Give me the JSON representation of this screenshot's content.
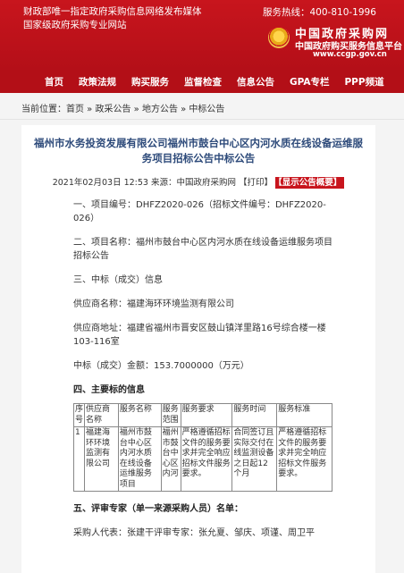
{
  "topbar": {
    "left_text": "财政部唯一指定政府采购信息网络发布媒体 国家级政府采购专业网站",
    "hotline": "服务热线：400-810-1996",
    "brand_line1": "中国政府采购网",
    "brand_line2": "中国政府购买服务信息平台",
    "brand_url": "www.ccgp.gov.cn"
  },
  "nav": [
    "首页",
    "政策法规",
    "购买服务",
    "监督检查",
    "信息公告",
    "GPA专栏",
    "PPP频道"
  ],
  "breadcrumb": "当前位置：首页 » 政采公告 » 地方公告 » 中标公告",
  "article": {
    "title": "福州市水务投资发展有限公司福州市鼓台中心区内河水质在线设备运维服务项目招标公告中标公告",
    "meta_date": "2021年02月03日 12:53 来源：中国政府采购网",
    "print_label": "【打印】",
    "summary_label": "【显示公告概要】",
    "sec1": "一、项目编号：DHFZ2020-026（招标文件编号：DHFZ2020-026）",
    "sec2": "二、项目名称：福州市鼓台中心区内河水质在线设备运维服务项目招标公告",
    "sec3": "三、中标（成交）信息",
    "supplier_name": "供应商名称：福建海环环境监测有限公司",
    "supplier_addr": "供应商地址：福建省福州市晋安区鼓山镇洋里路16号综合楼一楼103-116室",
    "amount": "中标（成交）金额：153.7000000（万元）",
    "sec4": "四、主要标的信息",
    "table_headers": [
      "序号",
      "供应商名称",
      "服务名称",
      "服务范围",
      "服务要求",
      "服务时间",
      "服务标准"
    ],
    "table_row": [
      "1",
      "福建海环环境监测有限公司",
      "福州市鼓台中心区内河水质在线设备运维服务项目",
      "福州市鼓台中心区内河",
      "严格遵循招标文件的服务要求并完全响应招标文件服务要求。",
      "合同签订且实际交付在线监测设备之日起12个月",
      "严格遵循招标文件的服务要求并完全响应招标文件服务要求。"
    ],
    "sec5": "五、评审专家（单一来源采购人员）名单：",
    "experts": "采购人代表：张建干评审专家：张允夏、邹庆、项谨、周卫平"
  }
}
